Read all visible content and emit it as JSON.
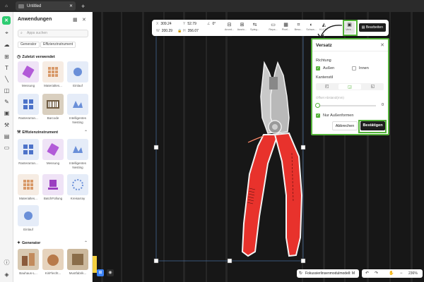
{
  "topbar": {
    "tab_title": "Untitled",
    "new_tab": "+"
  },
  "panel": {
    "title": "Anwendungen",
    "search_placeholder": "Apps suchen",
    "chips": [
      "Generator",
      "Effizienzinstrument"
    ],
    "recent": {
      "title": "Zuletzt verwendet",
      "items": [
        "Messung",
        "Materialtes...",
        "Einlauf",
        "Rasterarran...",
        "Barcode",
        "Intelligentes Nesting"
      ]
    },
    "efficiency": {
      "title": "Effizienzinstrument",
      "items": [
        "Rasterarran...",
        "Messung",
        "Intelligentes Nesting",
        "Materialtes...",
        "BatchFüllung",
        "Kreisarray",
        "Einlauf"
      ]
    },
    "generator": {
      "title": "Generator",
      "items": [
        "Bauhaus-L...",
        "KiriFlecht...",
        "Mustfabrik..."
      ]
    }
  },
  "toolbar": {
    "fields": [
      {
        "k": "X",
        "v": "309.24"
      },
      {
        "k": "Y",
        "v": "52.79"
      },
      {
        "k": "W",
        "v": "200.29"
      },
      {
        "k": "H",
        "v": "356.07"
      },
      {
        "k": "∠",
        "v": "0°"
      }
    ],
    "tools": [
      "Anord...",
      "Ausric...",
      "Spieg...",
      "Repa...",
      "Pixel...",
      "Beso...",
      "Schwa...",
      "KI-Ck...",
      "Vers..."
    ],
    "edit_label": "Bearbeiten"
  },
  "dialog": {
    "title": "Versatz",
    "direction_label": "Richtung",
    "outer": "Außen",
    "inner": "Innen",
    "edge_label": "Kantenstil",
    "offset_label": "Offset Abstand(mm)",
    "offset_value": "0",
    "outer_only": "Nur Außenformen",
    "cancel": "Abbrechen",
    "confirm": "Bestätigen"
  },
  "status": {
    "focus_mode": "Fokussierlinsenmodulmodell: M",
    "zoom": "236%"
  },
  "colors": {
    "accent": "#55b33b",
    "handle_red": "#e8322c"
  }
}
